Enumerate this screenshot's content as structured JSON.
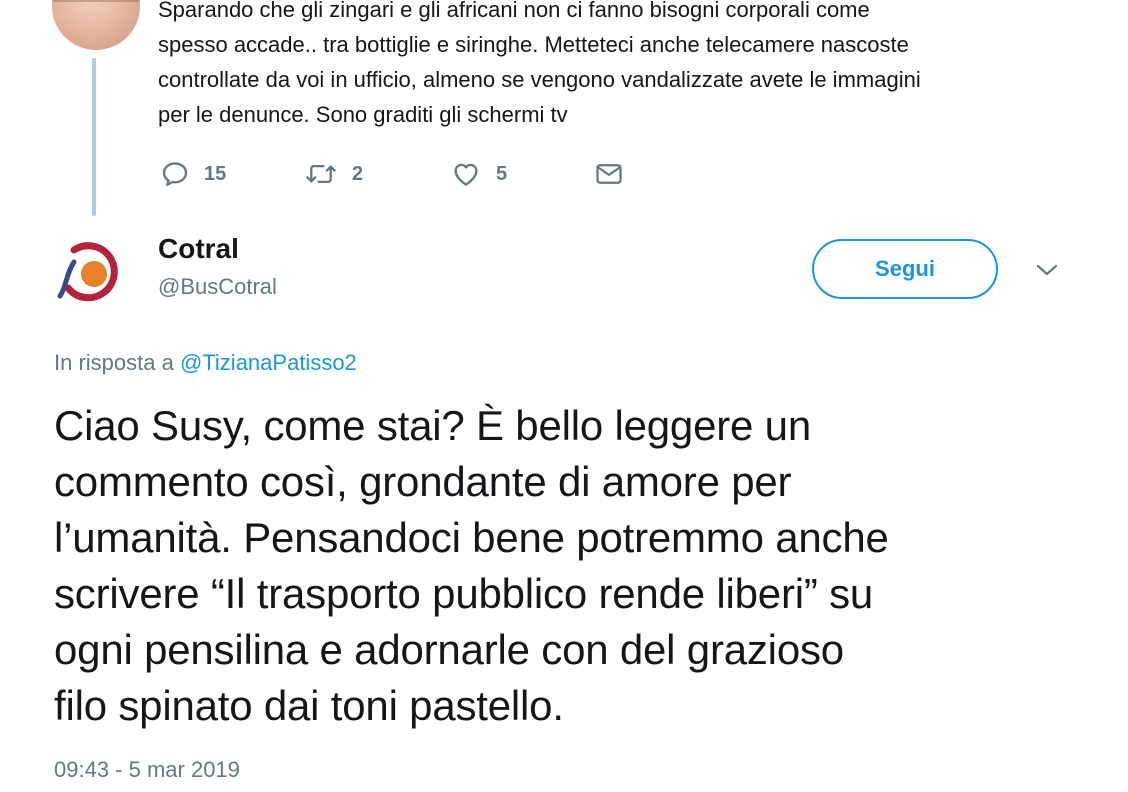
{
  "parent_tweet": {
    "text_lines": [
      "Sparando che gli zingari e gli africani non ci fanno bisogni corporali come",
      "spesso accade.. tra bottiglie e siringhe.  Metteteci anche telecamere nascoste",
      "controllate da voi in ufficio, almeno se vengono vandalizzate avete le immagini",
      "per le denunce. Sono graditi gli schermi tv"
    ],
    "actions": {
      "reply_count": "15",
      "retweet_count": "2",
      "like_count": "5"
    }
  },
  "reply_tweet": {
    "author_name": "Cotral",
    "author_handle": "@BusCotral",
    "follow_label": "Segui",
    "reply_prefix": "In risposta a",
    "reply_to": "@TizianaPatisso2",
    "text_lines": [
      "Ciao Susy, come stai? È bello leggere un",
      "commento così, grondante di amore per",
      "l’umanità. Pensandoci bene potremmo anche",
      "scrivere “Il trasporto pubblico rende liberi” su",
      "ogni pensilina e adornarle con del grazioso",
      "filo spinato dai toni pastello."
    ],
    "timestamp": "09:43 - 5 mar 2019"
  },
  "icons": {
    "reply": "reply-icon",
    "retweet": "retweet-icon",
    "like": "heart-icon",
    "message": "envelope-icon",
    "more": "chevron-down-icon",
    "logo": "cotral-logo"
  },
  "colors": {
    "accent": "#1b95e0",
    "muted": "#657786",
    "text": "#14171a",
    "thread_line": "#a9cfe0",
    "logo_red": "#b5223b",
    "logo_orange": "#e8812a",
    "logo_blue": "#3a4a8a"
  }
}
